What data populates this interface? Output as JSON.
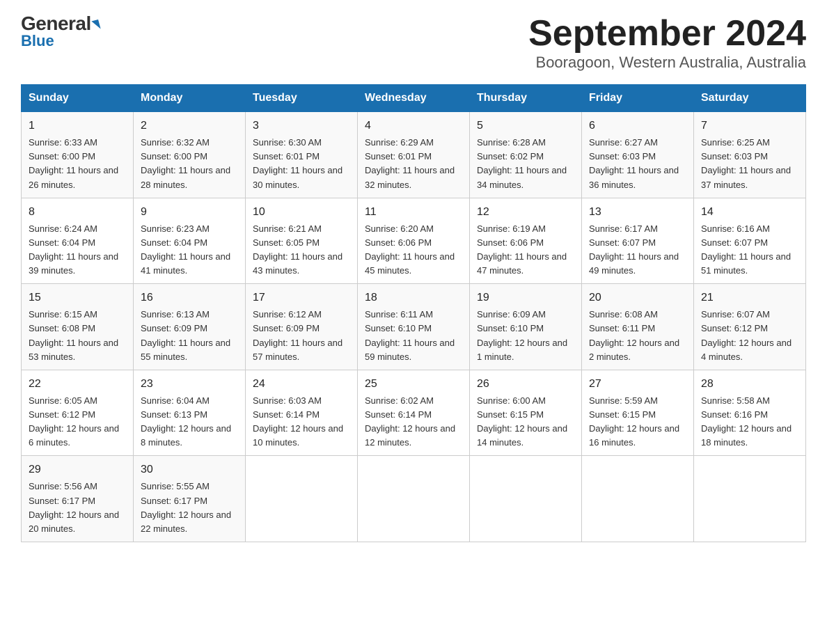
{
  "header": {
    "logo_top": "General",
    "logo_blue": "Blue",
    "title": "September 2024",
    "subtitle": "Booragoon, Western Australia, Australia"
  },
  "days_of_week": [
    "Sunday",
    "Monday",
    "Tuesday",
    "Wednesday",
    "Thursday",
    "Friday",
    "Saturday"
  ],
  "weeks": [
    [
      {
        "num": "1",
        "sunrise": "6:33 AM",
        "sunset": "6:00 PM",
        "daylight": "11 hours and 26 minutes."
      },
      {
        "num": "2",
        "sunrise": "6:32 AM",
        "sunset": "6:00 PM",
        "daylight": "11 hours and 28 minutes."
      },
      {
        "num": "3",
        "sunrise": "6:30 AM",
        "sunset": "6:01 PM",
        "daylight": "11 hours and 30 minutes."
      },
      {
        "num": "4",
        "sunrise": "6:29 AM",
        "sunset": "6:01 PM",
        "daylight": "11 hours and 32 minutes."
      },
      {
        "num": "5",
        "sunrise": "6:28 AM",
        "sunset": "6:02 PM",
        "daylight": "11 hours and 34 minutes."
      },
      {
        "num": "6",
        "sunrise": "6:27 AM",
        "sunset": "6:03 PM",
        "daylight": "11 hours and 36 minutes."
      },
      {
        "num": "7",
        "sunrise": "6:25 AM",
        "sunset": "6:03 PM",
        "daylight": "11 hours and 37 minutes."
      }
    ],
    [
      {
        "num": "8",
        "sunrise": "6:24 AM",
        "sunset": "6:04 PM",
        "daylight": "11 hours and 39 minutes."
      },
      {
        "num": "9",
        "sunrise": "6:23 AM",
        "sunset": "6:04 PM",
        "daylight": "11 hours and 41 minutes."
      },
      {
        "num": "10",
        "sunrise": "6:21 AM",
        "sunset": "6:05 PM",
        "daylight": "11 hours and 43 minutes."
      },
      {
        "num": "11",
        "sunrise": "6:20 AM",
        "sunset": "6:06 PM",
        "daylight": "11 hours and 45 minutes."
      },
      {
        "num": "12",
        "sunrise": "6:19 AM",
        "sunset": "6:06 PM",
        "daylight": "11 hours and 47 minutes."
      },
      {
        "num": "13",
        "sunrise": "6:17 AM",
        "sunset": "6:07 PM",
        "daylight": "11 hours and 49 minutes."
      },
      {
        "num": "14",
        "sunrise": "6:16 AM",
        "sunset": "6:07 PM",
        "daylight": "11 hours and 51 minutes."
      }
    ],
    [
      {
        "num": "15",
        "sunrise": "6:15 AM",
        "sunset": "6:08 PM",
        "daylight": "11 hours and 53 minutes."
      },
      {
        "num": "16",
        "sunrise": "6:13 AM",
        "sunset": "6:09 PM",
        "daylight": "11 hours and 55 minutes."
      },
      {
        "num": "17",
        "sunrise": "6:12 AM",
        "sunset": "6:09 PM",
        "daylight": "11 hours and 57 minutes."
      },
      {
        "num": "18",
        "sunrise": "6:11 AM",
        "sunset": "6:10 PM",
        "daylight": "11 hours and 59 minutes."
      },
      {
        "num": "19",
        "sunrise": "6:09 AM",
        "sunset": "6:10 PM",
        "daylight": "12 hours and 1 minute."
      },
      {
        "num": "20",
        "sunrise": "6:08 AM",
        "sunset": "6:11 PM",
        "daylight": "12 hours and 2 minutes."
      },
      {
        "num": "21",
        "sunrise": "6:07 AM",
        "sunset": "6:12 PM",
        "daylight": "12 hours and 4 minutes."
      }
    ],
    [
      {
        "num": "22",
        "sunrise": "6:05 AM",
        "sunset": "6:12 PM",
        "daylight": "12 hours and 6 minutes."
      },
      {
        "num": "23",
        "sunrise": "6:04 AM",
        "sunset": "6:13 PM",
        "daylight": "12 hours and 8 minutes."
      },
      {
        "num": "24",
        "sunrise": "6:03 AM",
        "sunset": "6:14 PM",
        "daylight": "12 hours and 10 minutes."
      },
      {
        "num": "25",
        "sunrise": "6:02 AM",
        "sunset": "6:14 PM",
        "daylight": "12 hours and 12 minutes."
      },
      {
        "num": "26",
        "sunrise": "6:00 AM",
        "sunset": "6:15 PM",
        "daylight": "12 hours and 14 minutes."
      },
      {
        "num": "27",
        "sunrise": "5:59 AM",
        "sunset": "6:15 PM",
        "daylight": "12 hours and 16 minutes."
      },
      {
        "num": "28",
        "sunrise": "5:58 AM",
        "sunset": "6:16 PM",
        "daylight": "12 hours and 18 minutes."
      }
    ],
    [
      {
        "num": "29",
        "sunrise": "5:56 AM",
        "sunset": "6:17 PM",
        "daylight": "12 hours and 20 minutes."
      },
      {
        "num": "30",
        "sunrise": "5:55 AM",
        "sunset": "6:17 PM",
        "daylight": "12 hours and 22 minutes."
      },
      null,
      null,
      null,
      null,
      null
    ]
  ],
  "labels": {
    "sunrise": "Sunrise:",
    "sunset": "Sunset:",
    "daylight": "Daylight:"
  }
}
